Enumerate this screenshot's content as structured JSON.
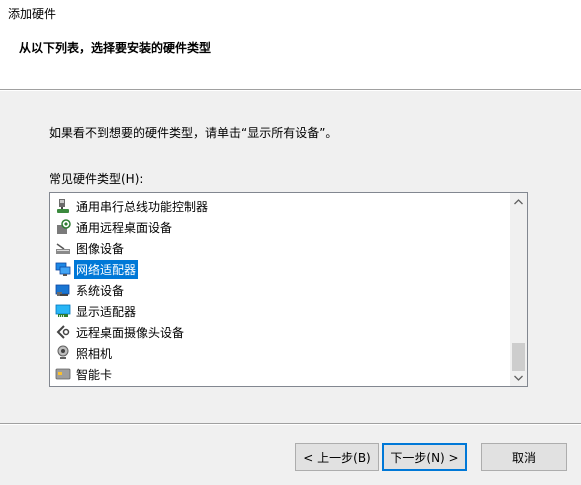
{
  "window": {
    "title": "添加硬件"
  },
  "header": {
    "title": "从以下列表，选择要安装的硬件类型"
  },
  "body": {
    "instruction": "如果看不到想要的硬件类型，请单击“显示所有设备”。",
    "list_label": "常见硬件类型(H):"
  },
  "hardware_list": {
    "items": [
      {
        "label": "通用串行总线功能控制器",
        "icon": "usb-controller-icon"
      },
      {
        "label": "通用远程桌面设备",
        "icon": "remote-desktop-icon"
      },
      {
        "label": "图像设备",
        "icon": "scanner-icon"
      },
      {
        "label": "网络适配器",
        "icon": "network-adapter-icon"
      },
      {
        "label": "系统设备",
        "icon": "system-device-icon"
      },
      {
        "label": "显示适配器",
        "icon": "display-adapter-icon"
      },
      {
        "label": "远程桌面摄像头设备",
        "icon": "camera-arrow-icon"
      },
      {
        "label": "照相机",
        "icon": "webcam-icon"
      },
      {
        "label": "智能卡",
        "icon": "smart-card-icon"
      }
    ],
    "selected_index": 3
  },
  "buttons": {
    "back": "< 上一步(B)",
    "next": "下一步(N) >",
    "cancel": "取消"
  },
  "colors": {
    "selection": "#0078d7",
    "default_button_border": "#0078d7"
  }
}
